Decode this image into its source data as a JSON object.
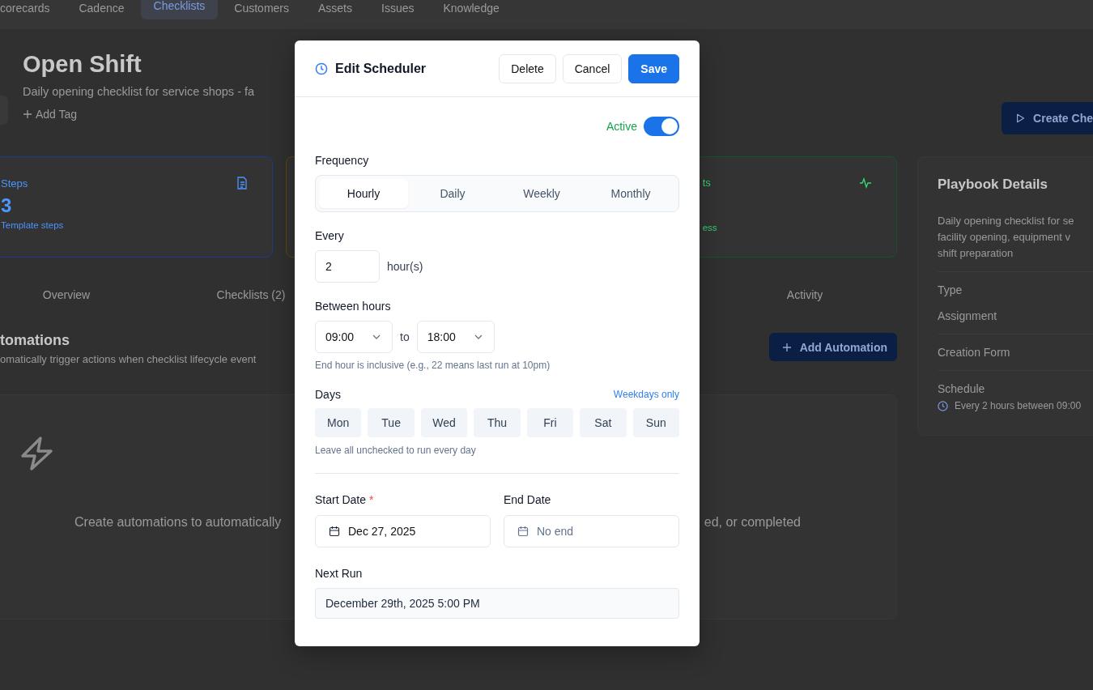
{
  "nav_tabs": [
    {
      "label": "corecards",
      "selected": false
    },
    {
      "label": "Cadence",
      "selected": false
    },
    {
      "label": "Checklists",
      "selected": true
    },
    {
      "label": "Customers",
      "selected": false
    },
    {
      "label": "Assets",
      "selected": false
    },
    {
      "label": "Issues",
      "selected": false
    },
    {
      "label": "Knowledge",
      "selected": false
    }
  ],
  "header": {
    "title": "Open Shift",
    "description": "Daily opening checklist for service shops - fa",
    "add_tag": "Add Tag",
    "create_button": "Create Che"
  },
  "stats": [
    {
      "kind": "steps",
      "label": "Steps",
      "value": "3",
      "caption": "Template steps",
      "color": "#1e3a8a"
    },
    {
      "kind": "hidden",
      "color": "#5c4a10"
    },
    {
      "kind": "activity",
      "label": "ts",
      "caption": "ess",
      "color": "#14532d"
    }
  ],
  "detail_tabs": [
    {
      "label": "Overview",
      "selected": false
    },
    {
      "label": "Checklists (2)",
      "selected": false
    },
    {
      "label": "Activity",
      "selected": false
    }
  ],
  "automations": {
    "title": "tomations",
    "subtitle": "omatically trigger actions when checklist lifecycle event",
    "add_button": "Add Automation",
    "empty_text_left": "Create automations to automatically",
    "empty_text_right": "ed, or completed"
  },
  "details_panel": {
    "title": "Playbook Details",
    "description_lines": [
      "Daily opening checklist for se",
      "facility opening, equipment v",
      "shift preparation"
    ],
    "sections": [
      {
        "labels": [
          "Type",
          "Assignment"
        ]
      },
      {
        "labels": [
          "Creation Form"
        ]
      },
      {
        "labels": [
          "Schedule"
        ],
        "value": "Every 2 hours between 09:00"
      }
    ]
  },
  "modal": {
    "title": "Edit Scheduler",
    "buttons": [
      {
        "label": "Delete",
        "kind": "secondary"
      },
      {
        "label": "Cancel",
        "kind": "secondary"
      },
      {
        "label": "Save",
        "kind": "primary"
      }
    ],
    "status": {
      "label": "Active",
      "on": true
    },
    "frequency": {
      "label": "Frequency",
      "options": [
        {
          "label": "Hourly",
          "selected": true
        },
        {
          "label": "Daily",
          "selected": false
        },
        {
          "label": "Weekly",
          "selected": false
        },
        {
          "label": "Monthly",
          "selected": false
        }
      ]
    },
    "every": {
      "label": "Every",
      "value": "2",
      "unit": "hour(s)"
    },
    "between": {
      "label": "Between hours",
      "from": "09:00",
      "joiner": "to",
      "to": "18:00",
      "hint": "End hour is inclusive (e.g., 22 means last run at 10pm)"
    },
    "days": {
      "label": "Days",
      "shortcut": "Weekdays only",
      "options": [
        {
          "label": "Mon",
          "selected": false
        },
        {
          "label": "Tue",
          "selected": false
        },
        {
          "label": "Wed",
          "selected": false
        },
        {
          "label": "Thu",
          "selected": false
        },
        {
          "label": "Fri",
          "selected": false
        },
        {
          "label": "Sat",
          "selected": false
        },
        {
          "label": "Sun",
          "selected": false
        }
      ],
      "hint": "Leave all unchecked to run every day"
    },
    "start_date": {
      "label": "Start Date",
      "required_mark": "*",
      "value": "Dec 27, 2025"
    },
    "end_date": {
      "label": "End Date",
      "placeholder": "No end"
    },
    "next_run": {
      "label": "Next Run",
      "value": "December 29th, 2025 5:00 PM"
    }
  }
}
